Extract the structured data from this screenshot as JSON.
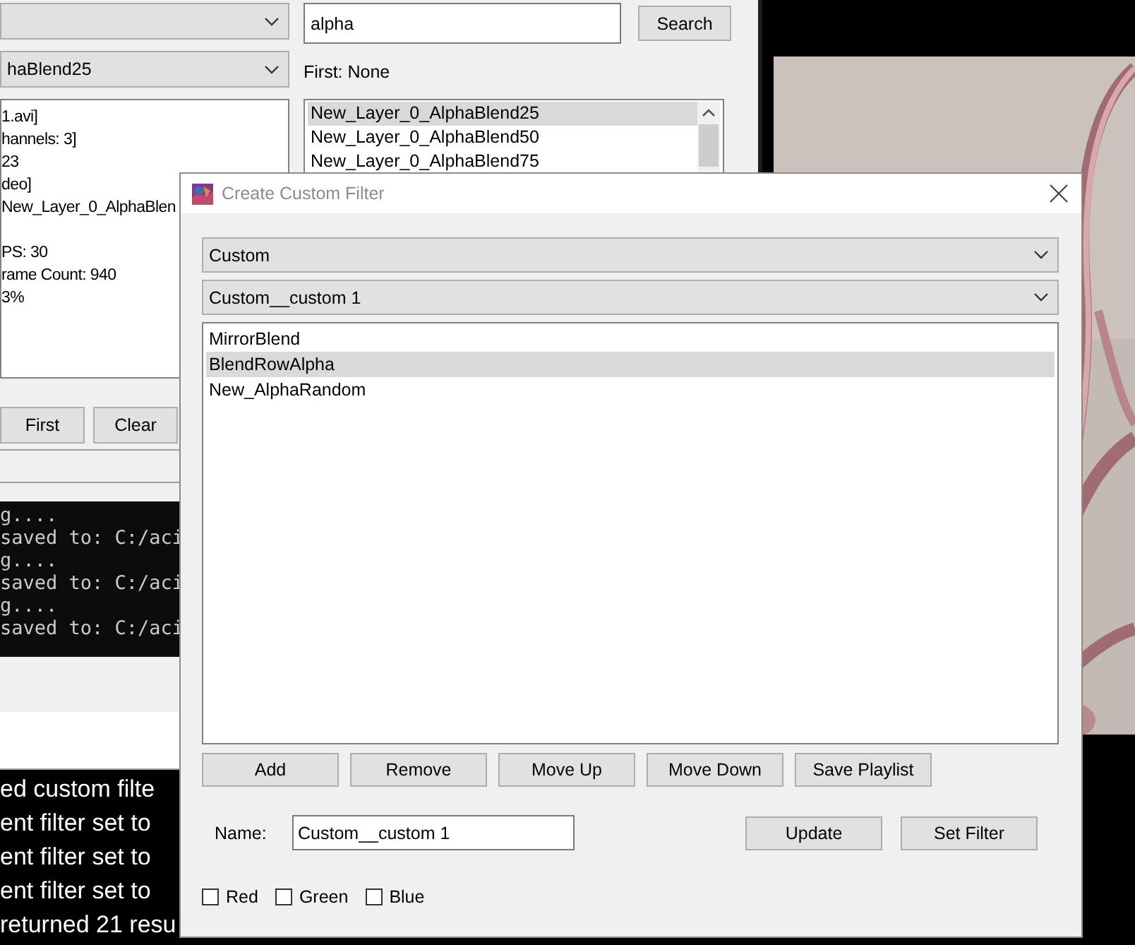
{
  "background_window": {
    "filter_dropdown": {
      "value": "haBlend25"
    },
    "search": {
      "value": "alpha",
      "button": "Search"
    },
    "first_label": "First: None",
    "info_lines": [
      "1.avi]",
      "hannels: 3]",
      "23",
      "deo]",
      "New_Layer_0_AlphaBlen",
      "PS: 30",
      "rame Count: 940",
      "3%"
    ],
    "results": [
      {
        "label": "New_Layer_0_AlphaBlend25",
        "selected": true
      },
      {
        "label": "New_Layer_0_AlphaBlend50",
        "selected": false
      },
      {
        "label": "New_Layer_0_AlphaBlend75",
        "selected": false
      }
    ],
    "buttons": [
      "First",
      "Clear"
    ],
    "console_lines": [
      "g....",
      "saved to: C:/aci",
      "g....",
      "saved to: C:/aci",
      "g....",
      "saved to: C:/aci"
    ],
    "log_lines": [
      "ed custom filte",
      "ent filter set to",
      "ent filter set to",
      "ent filter set to",
      "returned 21 resu"
    ]
  },
  "dialog": {
    "title": "Create Custom Filter",
    "category": "Custom",
    "filter": "Custom__custom 1",
    "filters": [
      {
        "label": "MirrorBlend",
        "selected": false
      },
      {
        "label": "BlendRowAlpha",
        "selected": true
      },
      {
        "label": "New_AlphaRandom",
        "selected": false
      }
    ],
    "buttons": [
      "Add",
      "Remove",
      "Move Up",
      "Move Down",
      "Save Playlist"
    ],
    "name_label": "Name:",
    "name_value": "Custom__custom 1",
    "actions": [
      "Update",
      "Set Filter"
    ],
    "channels": [
      {
        "label": "Red",
        "checked": false
      },
      {
        "label": "Green",
        "checked": false
      },
      {
        "label": "Blue",
        "checked": false
      }
    ]
  }
}
